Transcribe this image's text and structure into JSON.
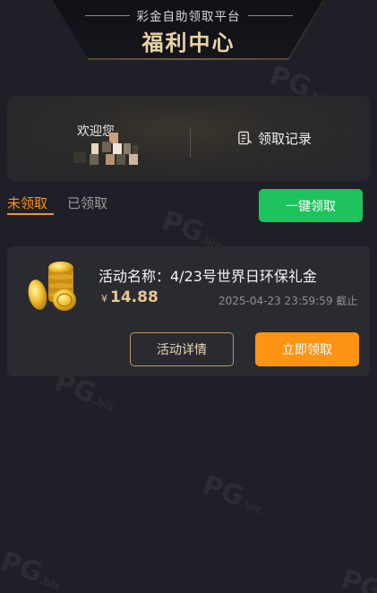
{
  "header": {
    "subtitle": "彩金自助领取平台",
    "title": "福利中心"
  },
  "welcome": {
    "greeting": "欢迎您",
    "records_label": "领取记录",
    "records_icon": "document-list-icon"
  },
  "tabs": [
    {
      "label": "未领取",
      "active": true
    },
    {
      "label": "已领取",
      "active": false
    }
  ],
  "claim_all_label": "一键领取",
  "activity": {
    "name": "活动名称：4/23号世界日环保礼金",
    "currency": "¥",
    "amount": "14.88",
    "deadline": "2025-04-23 23:59:59 截止",
    "details_label": "活动详情",
    "claim_label": "立即领取",
    "icon": "gold-coins-icon"
  },
  "watermark_text": "PG.biz",
  "colors": {
    "accent_orange": "#ff8f1f",
    "green": "#1fc35e",
    "gold": "#e8d3a7",
    "background": "#1f2027"
  }
}
